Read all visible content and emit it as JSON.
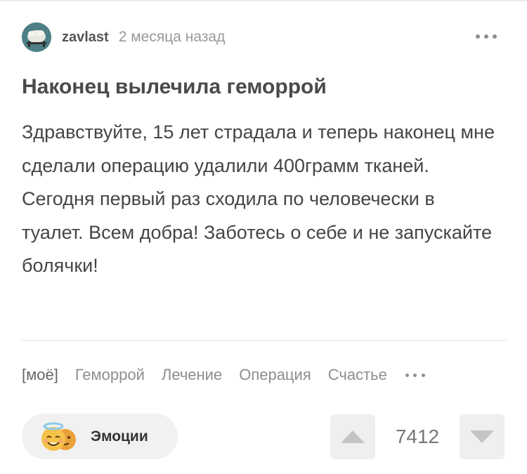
{
  "post": {
    "author": "zavlast",
    "time": "2 месяца назад",
    "title": "Наконец вылечила геморрой",
    "body": "Здравствуйте, 15 лет страдала и теперь наконец мне сделали операцию удалили 400грамм тканей. Сегодня первый раз сходила по человечески в туалет. Всем добра! Заботесь о себе и не запускайте болячки!"
  },
  "tags": [
    "[моё]",
    "Геморрой",
    "Лечение",
    "Операция",
    "Счастье"
  ],
  "actions": {
    "emotions_label": "Эмоции",
    "rating": "7412"
  },
  "icons": {
    "avatar": "avatar-image",
    "more": "more-dots-icon",
    "emotions": "angel-face-emoji-icon",
    "vote_up": "triangle-up-icon",
    "vote_down": "triangle-down-icon"
  },
  "colors": {
    "avatar_bg": "#4f7f86",
    "button_bg": "#efefef",
    "emoji_yellow": "#f4c542"
  }
}
